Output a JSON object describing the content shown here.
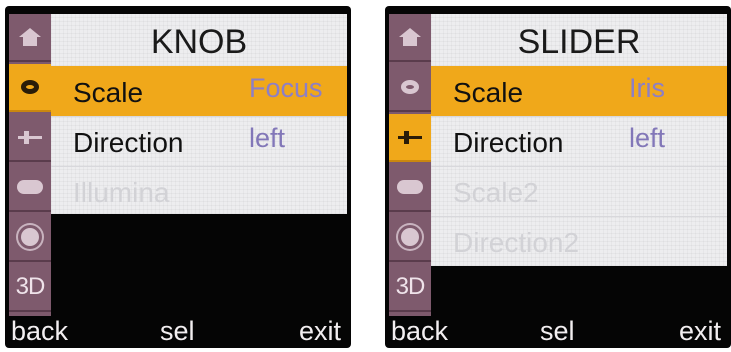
{
  "screens": [
    {
      "title": "KNOB",
      "selected_icon": "knob",
      "sidebar": [
        "home-icon",
        "knob-icon",
        "slider-icon",
        "button-icon",
        "gear-icon",
        "3d-icon"
      ],
      "sidebar_3d_label": "3D",
      "rows": [
        {
          "label": "Scale",
          "value": "Focus",
          "selected": true
        },
        {
          "label": "Direction",
          "value": "left",
          "selected": false
        },
        {
          "label": "Illumina",
          "value": "",
          "disabled": true
        }
      ],
      "softkeys": {
        "back": "back",
        "sel": "sel",
        "exit": "exit"
      }
    },
    {
      "title": "SLIDER",
      "selected_icon": "slider",
      "sidebar": [
        "home-icon",
        "knob-icon",
        "slider-icon",
        "button-icon",
        "gear-icon",
        "3d-icon"
      ],
      "sidebar_3d_label": "3D",
      "rows": [
        {
          "label": "Scale",
          "value": "Iris",
          "selected": true
        },
        {
          "label": "Direction",
          "value": "left",
          "selected": false
        },
        {
          "label": "Scale2",
          "value": "",
          "disabled": true
        },
        {
          "label": "Direction2",
          "value": "",
          "disabled": true
        }
      ],
      "softkeys": {
        "back": "back",
        "sel": "sel",
        "exit": "exit"
      }
    }
  ],
  "colors": {
    "sidebar": "#7e5a6d",
    "highlight": "#f0a81a",
    "panel": "#ededef",
    "value_text": "#8277b8",
    "screen_bg": "#050505"
  }
}
